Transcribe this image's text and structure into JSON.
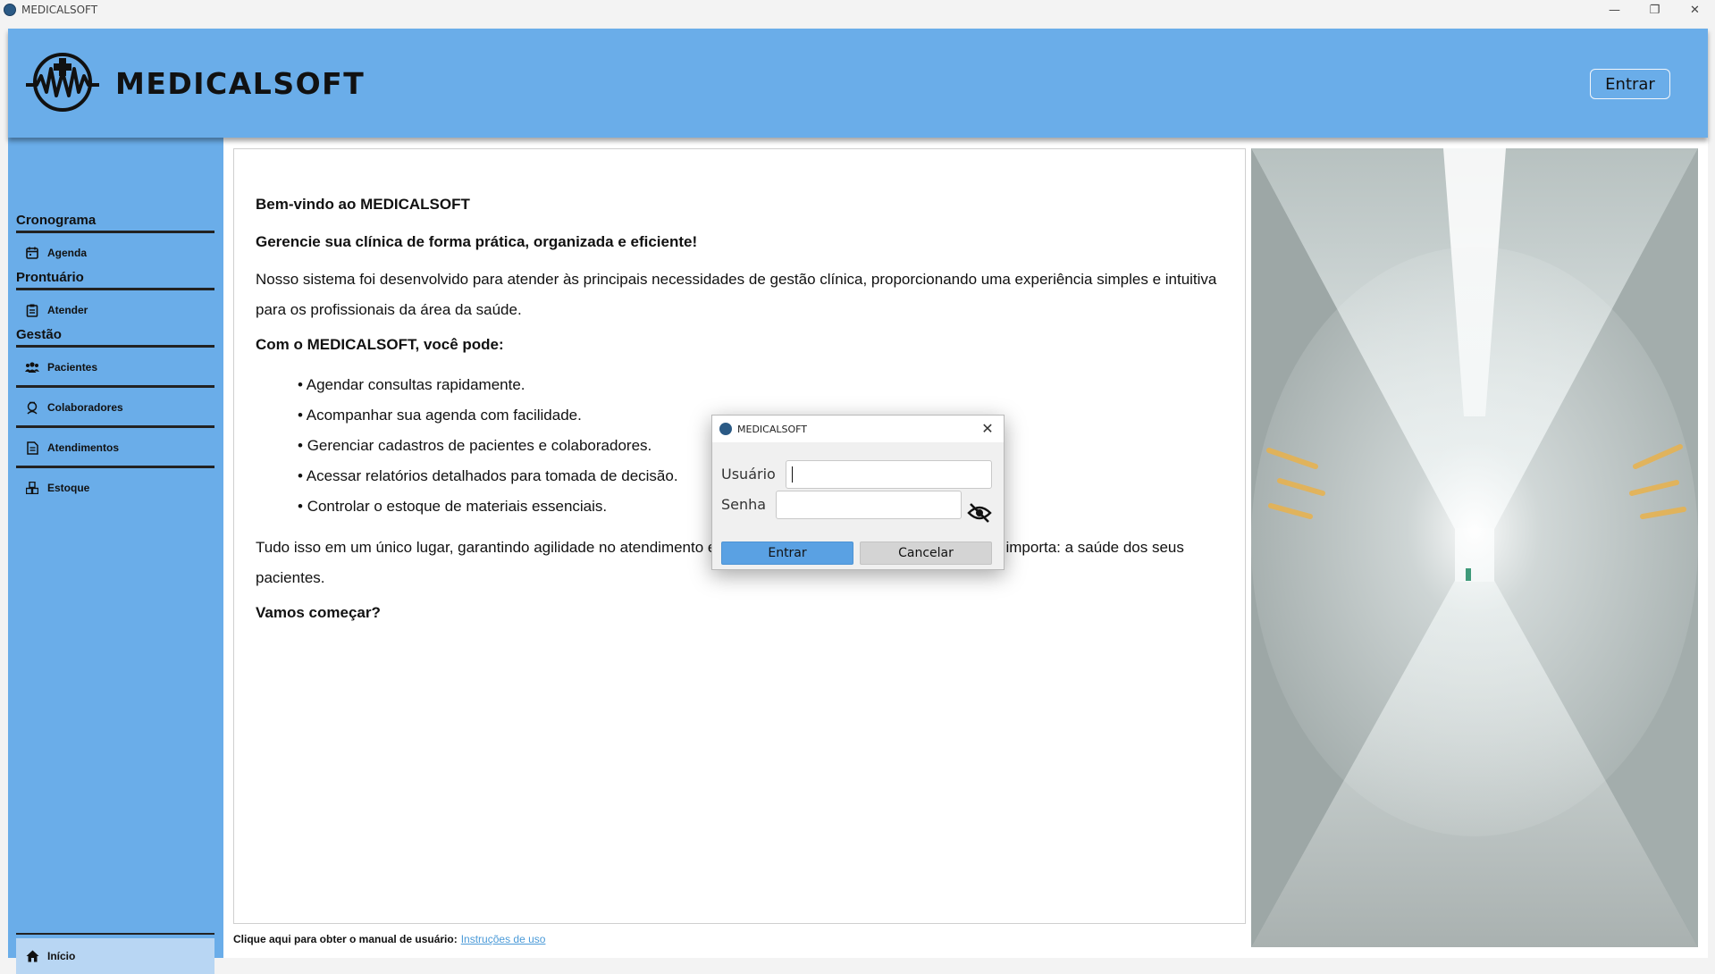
{
  "window": {
    "title": "MEDICALSOFT",
    "controls": {
      "minimize": "—",
      "restore": "❐",
      "close": "✕"
    }
  },
  "header": {
    "brand": "MEDICALSOFT",
    "login_button": "Entrar",
    "logo_icon": "medical-cross-heartbeat-logo"
  },
  "sidebar": {
    "sections": [
      {
        "title": "Cronograma",
        "items": [
          {
            "label": "Agenda",
            "icon": "calendar-icon"
          }
        ]
      },
      {
        "title": "Prontuário",
        "items": [
          {
            "label": "Atender",
            "icon": "clipboard-icon"
          }
        ]
      },
      {
        "title": "Gestão",
        "items": [
          {
            "label": "Pacientes",
            "icon": "users-icon"
          },
          {
            "label": "Colaboradores",
            "icon": "collaborator-icon"
          },
          {
            "label": "Atendimentos",
            "icon": "document-icon"
          },
          {
            "label": "Estoque",
            "icon": "boxes-icon"
          }
        ]
      }
    ],
    "home": {
      "label": "Início",
      "icon": "home-icon"
    }
  },
  "main": {
    "title": "Bem-vindo ao MEDICALSOFT",
    "subtitle": "Gerencie sua clínica de forma prática, organizada e eficiente!",
    "intro": "Nosso sistema foi desenvolvido para atender às principais necessidades de gestão clínica, proporcionando uma experiência simples e intuitiva para os profissionais da área da saúde.",
    "features_heading": "Com o MEDICALSOFT, você pode:",
    "features": [
      "Agendar consultas rapidamente.",
      "Acompanhar sua agenda com facilidade.",
      "Gerenciar cadastros de pacientes e colaboradores.",
      "Acessar relatórios detalhados para tomada de decisão.",
      "Controlar o estoque de materiais essenciais."
    ],
    "closing": "Tudo isso em um único lugar, garantindo agilidade no atendimento e mais tempo para cuidar do que realmente importa: a saúde dos seus pacientes.",
    "call_to_action": "Vamos começar?",
    "manual_text": "Clique aqui para obter o manual de usuário:",
    "manual_link": "Instruções de uso"
  },
  "login_dialog": {
    "title": "MEDICALSOFT",
    "close": "✕",
    "username_label": "Usuário",
    "username_value": "",
    "password_label": "Senha",
    "password_value": "",
    "toggle_icon": "eye-slash-icon",
    "submit": "Entrar",
    "cancel": "Cancelar"
  },
  "colors": {
    "header": "#6aade9",
    "sidebar": "#6aade9",
    "active_item": "#b8d6f3",
    "primary_button": "#5aa1e3",
    "link": "#4a9ad8"
  }
}
